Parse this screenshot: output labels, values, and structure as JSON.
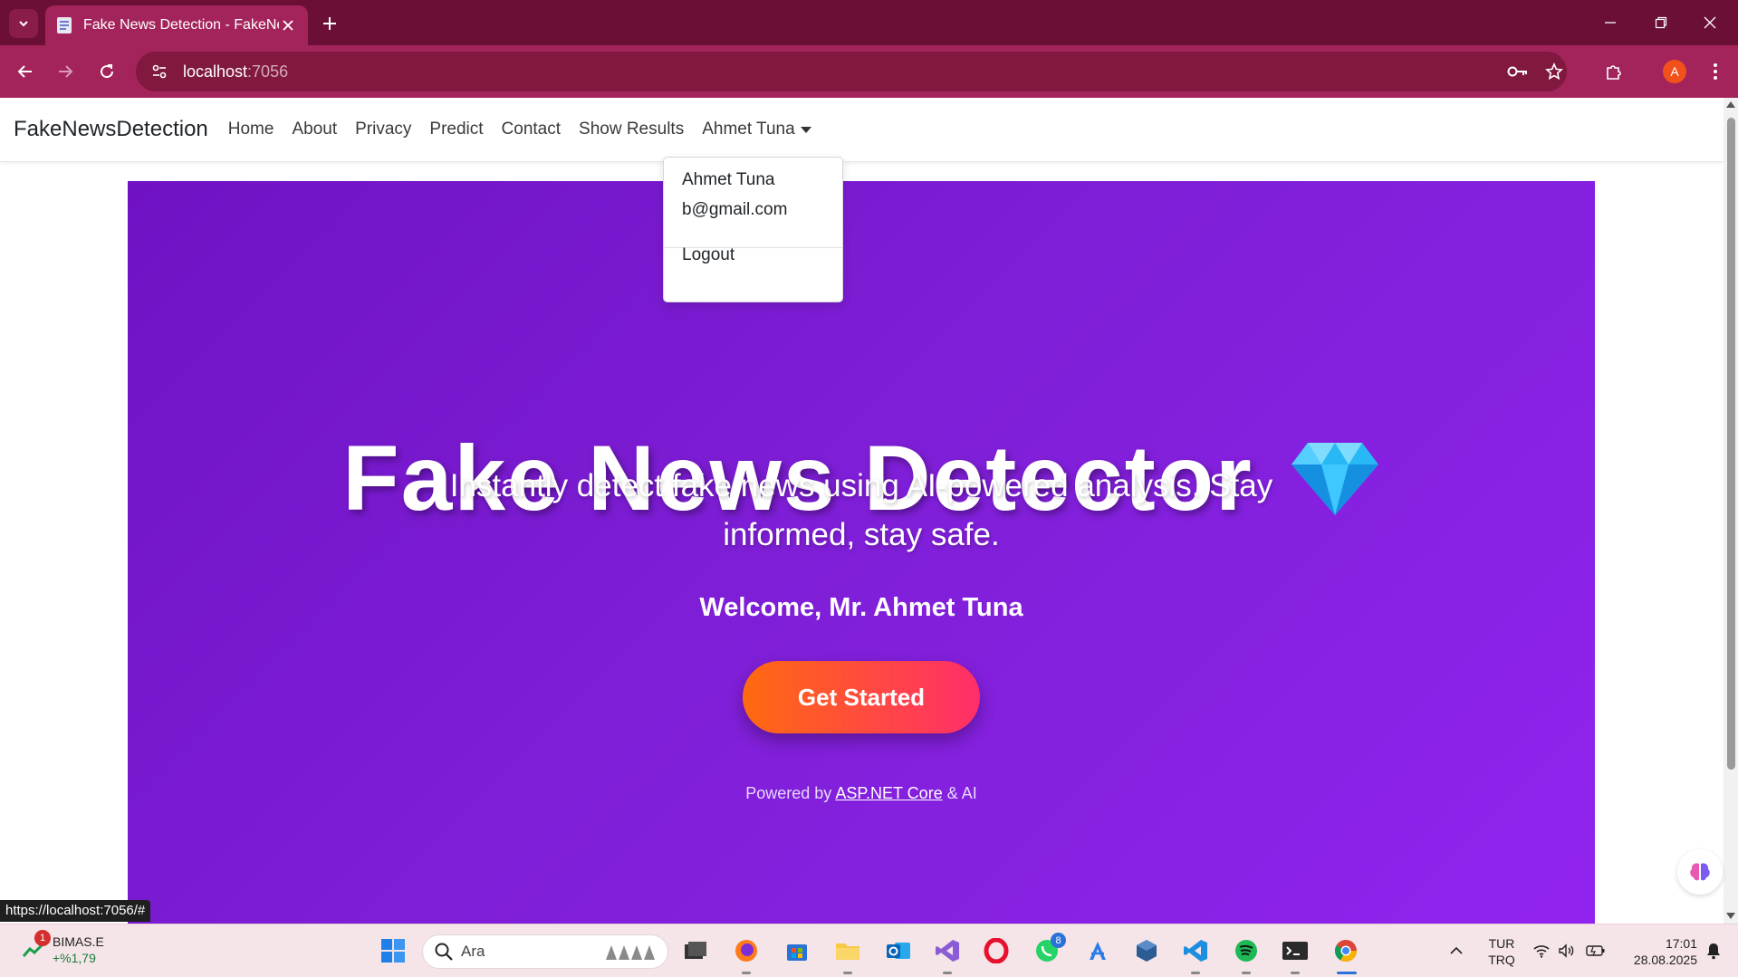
{
  "browser": {
    "tab_title": "Fake News Detection - FakeNewsDetection",
    "url_host": "localhost",
    "url_port": ":7056",
    "status_url": "https://localhost:7056/#",
    "profile_initial": "A"
  },
  "navbar": {
    "brand": "FakeNewsDetection",
    "links": [
      "Home",
      "About",
      "Privacy",
      "Predict",
      "Contact",
      "Show Results"
    ],
    "user": "Ahmet Tuna"
  },
  "dropdown": {
    "name": "Ahmet Tuna",
    "email": "b@gmail.com",
    "logout": "Logout"
  },
  "hero": {
    "title": "Fake News Detector",
    "subtitle": "Instantly detect fake news using AI-powered analysis. Stay informed, stay safe.",
    "welcome": "Welcome, Mr. Ahmet Tuna",
    "cta": "Get Started",
    "powered_prefix": "Powered by ",
    "powered_link": "ASP.NET Core",
    "powered_suffix": " & AI"
  },
  "taskbar": {
    "stock_badge": "1",
    "stock_name": "BIMAS.E",
    "stock_change": "+%1,79",
    "search_placeholder": "Ara",
    "whatsapp_badge": "8",
    "lang_1": "TUR",
    "lang_2": "TRQ",
    "time": "17:01",
    "date": "28.08.2025"
  },
  "colors": {
    "chrome_dark": "#6b0f36",
    "chrome_toolbar": "#a3245a",
    "hero_start": "#6f12c4",
    "hero_end": "#9124ef",
    "cta_start": "#ff6a10",
    "cta_end": "#ff2e6a"
  }
}
